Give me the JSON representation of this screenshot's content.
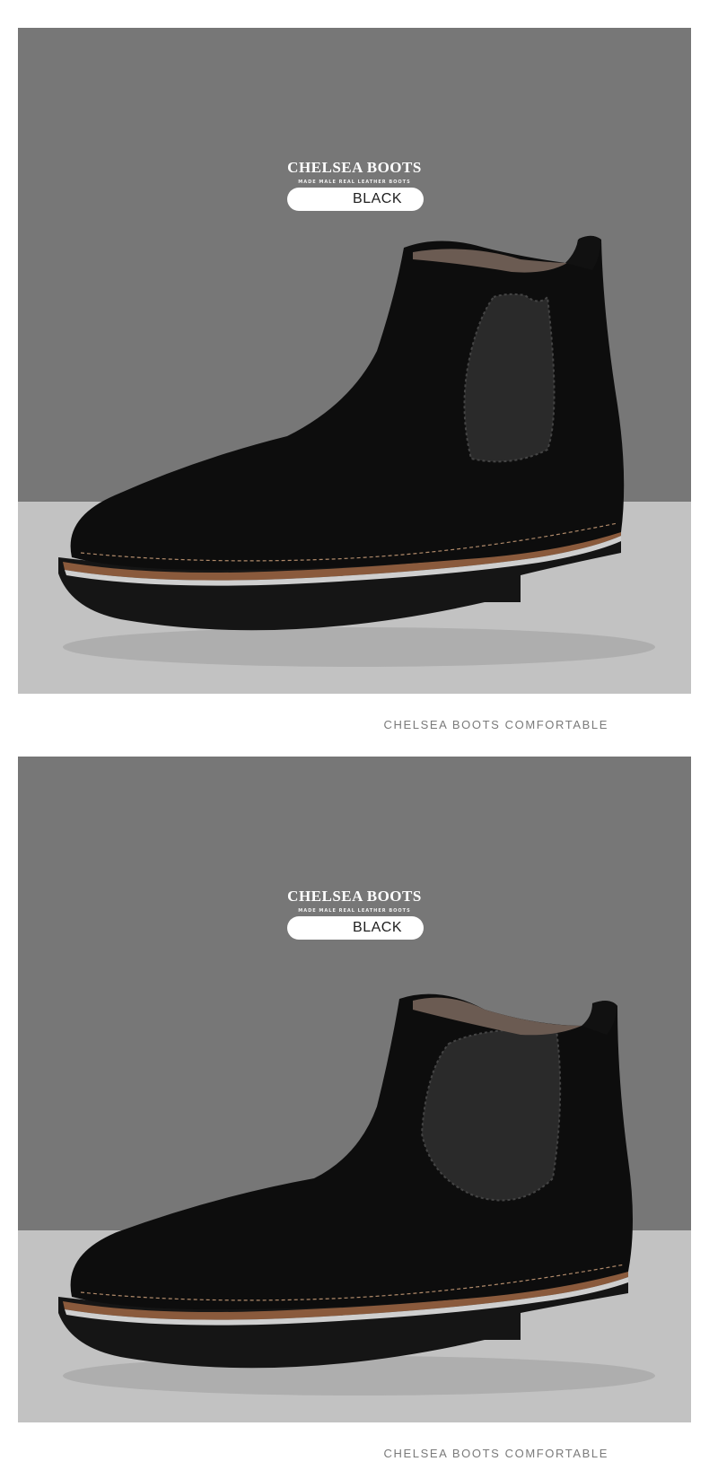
{
  "colors": {
    "backdrop_top": "#777777",
    "backdrop_bottom": "#c2c2c2",
    "boot": "#0d0d0d",
    "page_background": "#ffffff"
  },
  "panels": [
    {
      "brand_title": "CHELSEA BOOTS",
      "brand_subtitle": "MADE MALE REAL LEATHER BOOTS",
      "color_label": "BLACK",
      "caption": "CHELSEA BOOTS COMFORTABLE"
    },
    {
      "brand_title": "CHELSEA BOOTS",
      "brand_subtitle": "MADE MALE REAL LEATHER BOOTS",
      "color_label": "BLACK",
      "caption": "CHELSEA BOOTS COMFORTABLE"
    }
  ]
}
